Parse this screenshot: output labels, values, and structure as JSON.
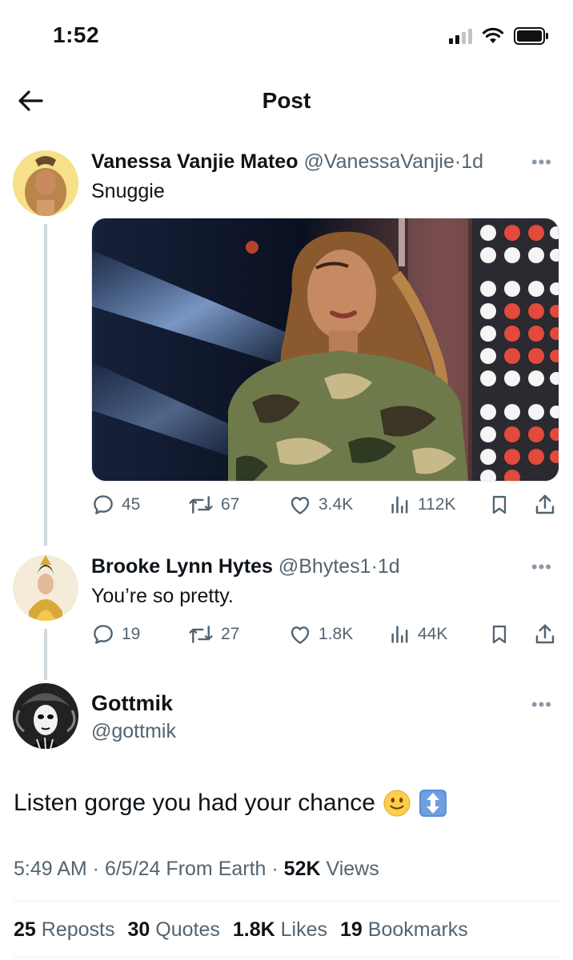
{
  "status_bar": {
    "time": "1:52"
  },
  "header": {
    "title": "Post"
  },
  "thread": [
    {
      "display_name": "Vanessa Vanjie Mateo",
      "handle": "@VanessaVanjie",
      "time": "1d",
      "text": "Snuggie",
      "actions": {
        "replies": "45",
        "reposts": "67",
        "likes": "3.4K",
        "views": "112K"
      }
    },
    {
      "display_name": "Brooke Lynn Hytes",
      "handle": "@Bhytes1",
      "time": "1d",
      "text": "You’re so pretty.",
      "actions": {
        "replies": "19",
        "reposts": "27",
        "likes": "1.8K",
        "views": "44K"
      }
    }
  ],
  "main_post": {
    "display_name": "Gottmik",
    "handle": "@gottmik",
    "text": "Listen gorge you had your chance",
    "meta": {
      "time": "5:49 AM",
      "date": "6/5/24",
      "source": "From Earth",
      "views_count": "52K",
      "views_label": "Views"
    },
    "stats": [
      {
        "count": "25",
        "label": "Reposts"
      },
      {
        "count": "30",
        "label": "Quotes"
      },
      {
        "count": "1.8K",
        "label": "Likes"
      },
      {
        "count": "19",
        "label": "Bookmarks"
      }
    ]
  },
  "colors": {
    "text": "#0f1419",
    "muted": "#536471",
    "thread_line": "#cfd9de"
  },
  "icons": [
    "back-arrow-icon",
    "reply-icon",
    "repost-icon",
    "like-icon",
    "views-icon",
    "bookmark-icon",
    "share-icon",
    "more-icon",
    "smiley-emoji",
    "up-down-arrow-emoji"
  ]
}
